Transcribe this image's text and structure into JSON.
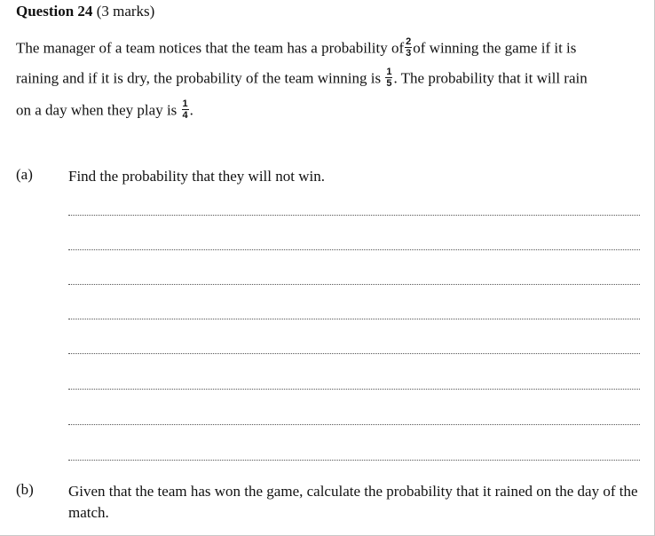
{
  "question": {
    "title_bold": "Question 24",
    "title_marks": " (3 marks)"
  },
  "stem": {
    "line1_a": "The manager of a team notices that the team has a probability of",
    "frac1": {
      "num": "2",
      "den": "3"
    },
    "line1_b": "of winning the game if it is",
    "line2_a": "raining and if it is dry, the probability of the team winning is",
    "frac2": {
      "num": "1",
      "den": "5"
    },
    "line2_b": ". The probability that it will rain",
    "line3_a": "on a day when they play is",
    "frac3": {
      "num": "1",
      "den": "4"
    },
    "line3_b": "."
  },
  "part_a": {
    "label": "(a)",
    "text": "Find the probability that they will not win."
  },
  "part_b": {
    "label": "(b)",
    "text": "Given that the team has won the game, calculate the probability that it rained on the day of the match."
  }
}
